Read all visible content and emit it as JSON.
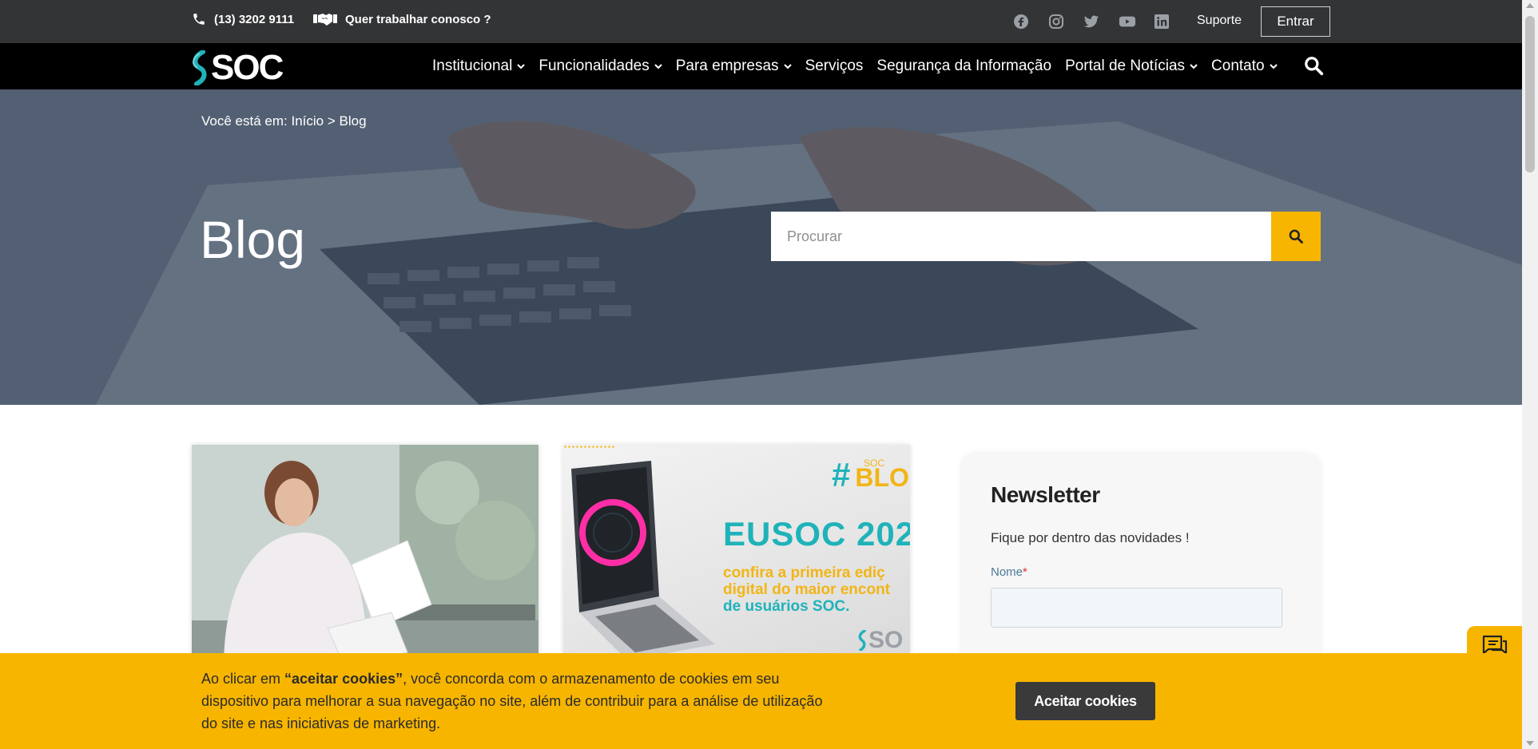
{
  "topbar": {
    "phone": "(13) 3202 9111",
    "work_with_us": "Quer trabalhar conosco ?",
    "social_icons": [
      "facebook-icon",
      "instagram-icon",
      "twitter-icon",
      "youtube-icon",
      "linkedin-icon"
    ],
    "support": "Suporte",
    "login": "Entrar"
  },
  "navbar": {
    "logo_text": "SOC",
    "items": [
      {
        "label": "Institucional",
        "dropdown": true
      },
      {
        "label": "Funcionalidades",
        "dropdown": true
      },
      {
        "label": "Para empresas",
        "dropdown": true
      },
      {
        "label": "Serviços",
        "dropdown": false
      },
      {
        "label": "Segurança da Informação",
        "dropdown": false
      },
      {
        "label": "Portal de Notícias",
        "dropdown": true
      },
      {
        "label": "Contato",
        "dropdown": true
      }
    ]
  },
  "hero": {
    "breadcrumb_prefix": "Você está em:",
    "breadcrumb_home": "Início",
    "breadcrumb_sep": ">",
    "breadcrumb_current": "Blog",
    "title": "Blog",
    "search_placeholder": "Procurar"
  },
  "cards": [
    {
      "image": "woman-reading-documents-photo"
    },
    {
      "image": "eusoc-banner",
      "tag_hash": "#",
      "tag_small": "SOC",
      "tag_big": "BLO",
      "headline": "EUSOC 202",
      "sub_line1": "confira a primeira ediç",
      "sub_line2": "digital do maior encont",
      "sub_line3": "de usuários SOC.",
      "logo": "SO"
    }
  ],
  "newsletter": {
    "title": "Newsletter",
    "tagline": "Fique por dentro das novidades !",
    "name_label": "Nome",
    "required_mark": "*"
  },
  "cookie": {
    "text_before": "Ao clicar em ",
    "text_bold": "“aceitar cookies”",
    "text_after": ", você concorda com o armazenamento de cookies em seu dispositivo para melhorar a sua navegação no site, além de contribuir para a análise de utilização do site e nas iniciativas de marketing.",
    "accept_button": "Aceitar cookies"
  },
  "colors": {
    "accent": "#f7b500",
    "topbar": "#333436",
    "navbar": "#000000",
    "teal": "#1fb3b9"
  }
}
